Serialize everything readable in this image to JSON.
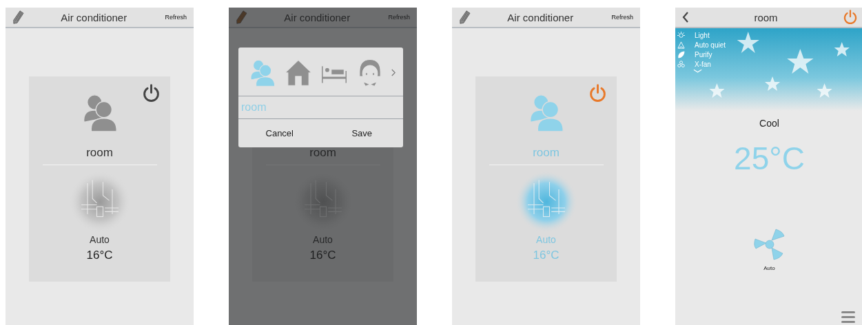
{
  "screens": [
    {
      "kind": "devices",
      "title": "Air conditioner",
      "action": "Refresh",
      "editing": false,
      "card": {
        "name": "room",
        "on": false,
        "mode": "Auto",
        "temperature": "16°C"
      }
    },
    {
      "kind": "devices",
      "title": "Air conditioner",
      "action": "Refresh",
      "editing": true,
      "card": {
        "name": "room",
        "on": false,
        "mode": "Auto",
        "temperature": "16°C"
      },
      "dialog": {
        "icons": [
          {
            "kind": "people",
            "selected": true
          },
          {
            "kind": "house",
            "selected": false
          },
          {
            "kind": "bed",
            "selected": false
          },
          {
            "kind": "girl",
            "selected": false
          }
        ],
        "value": "room",
        "buttons": [
          "Cancel",
          "Save"
        ]
      }
    },
    {
      "kind": "devices",
      "title": "Air conditioner",
      "action": "Refresh",
      "editing": false,
      "card": {
        "name": "room",
        "on": true,
        "mode": "Auto",
        "temperature": "16°C"
      }
    },
    {
      "kind": "control",
      "title": "room",
      "on": true,
      "features": [
        {
          "kind": "light",
          "label": "Light"
        },
        {
          "kind": "quiet",
          "label": "Auto quiet"
        },
        {
          "kind": "purify",
          "label": "Purify"
        },
        {
          "kind": "fan",
          "label": "X-fan"
        }
      ],
      "mode": "Cool",
      "temperature": "25°C",
      "fan": "Auto"
    }
  ]
}
